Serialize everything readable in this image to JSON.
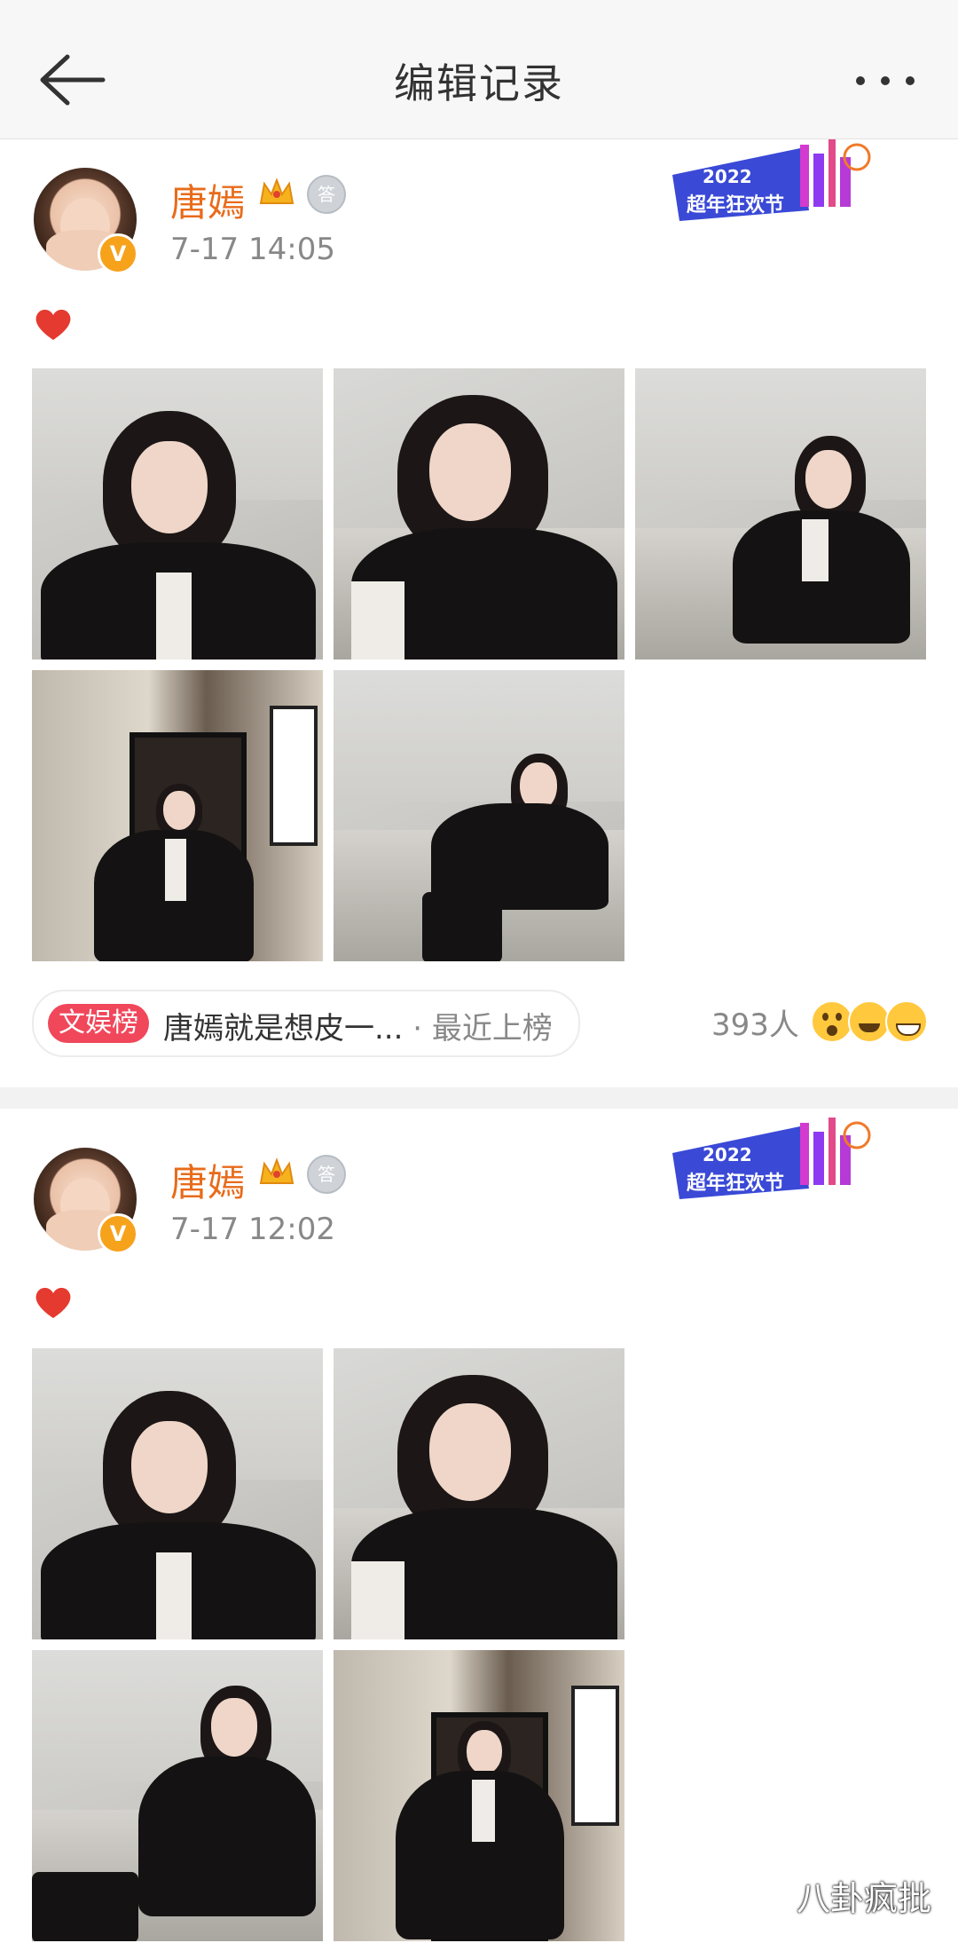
{
  "nav": {
    "title": "编辑记录",
    "back_icon": "back-arrow-icon",
    "more_icon": "more-dots-icon"
  },
  "posts": [
    {
      "username": "唐嫣",
      "time": "7-17 14:05",
      "content_emoji": "heart-icon",
      "banner_year": "2022",
      "banner_text": "超年狂欢节",
      "images": [
        "photo-1",
        "photo-2",
        "photo-3",
        "photo-4",
        "photo-5"
      ],
      "hot": {
        "tag": "文娱榜",
        "text": "唐嫣就是想皮一...",
        "sub": " · 最近上榜"
      },
      "reaction_count": "393人"
    },
    {
      "username": "唐嫣",
      "time": "7-17 12:02",
      "content_emoji": "heart-icon",
      "banner_year": "2022",
      "banner_text": "超年狂欢节",
      "images": [
        "photo-1",
        "photo-2",
        "photo-3",
        "photo-4"
      ]
    }
  ],
  "watermark": "八卦疯批",
  "colors": {
    "username": "#e86b1a",
    "hot_tag": "#f0475b",
    "vip_badge": "#f6a21b"
  }
}
